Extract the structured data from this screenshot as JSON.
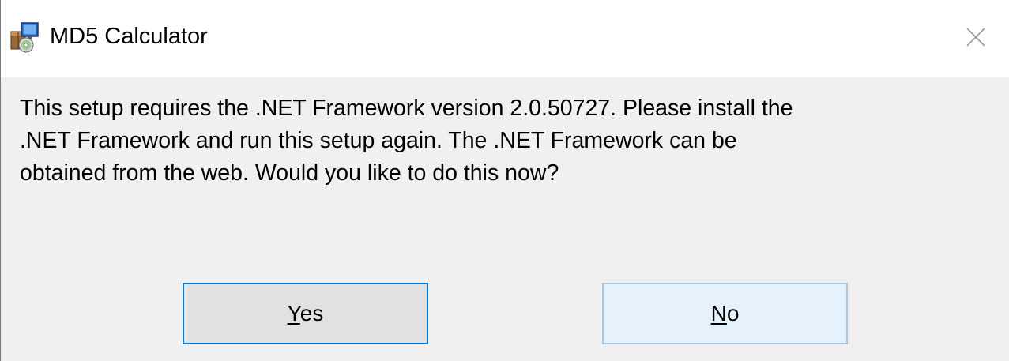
{
  "window": {
    "title": "MD5 Calculator",
    "app_icon": "installer-package-icon",
    "close_icon": "close-icon"
  },
  "message": {
    "lines": [
      "This setup requires the .NET Framework version 2.0.50727.  Please install the",
      ".NET Framework and run this setup again.  The .NET Framework can be",
      "obtained from the web.  Would you like to do this now?"
    ]
  },
  "buttons": {
    "yes": {
      "mnemonic": "Y",
      "rest": "es"
    },
    "no": {
      "mnemonic": "N",
      "rest": "o"
    }
  },
  "colors": {
    "title_bg": "#ffffff",
    "body_bg": "#f0f0f0",
    "button_bg": "#e1e1e1",
    "default_button_border": "#0078d7",
    "hover_button_bg": "#e5f1fb"
  }
}
